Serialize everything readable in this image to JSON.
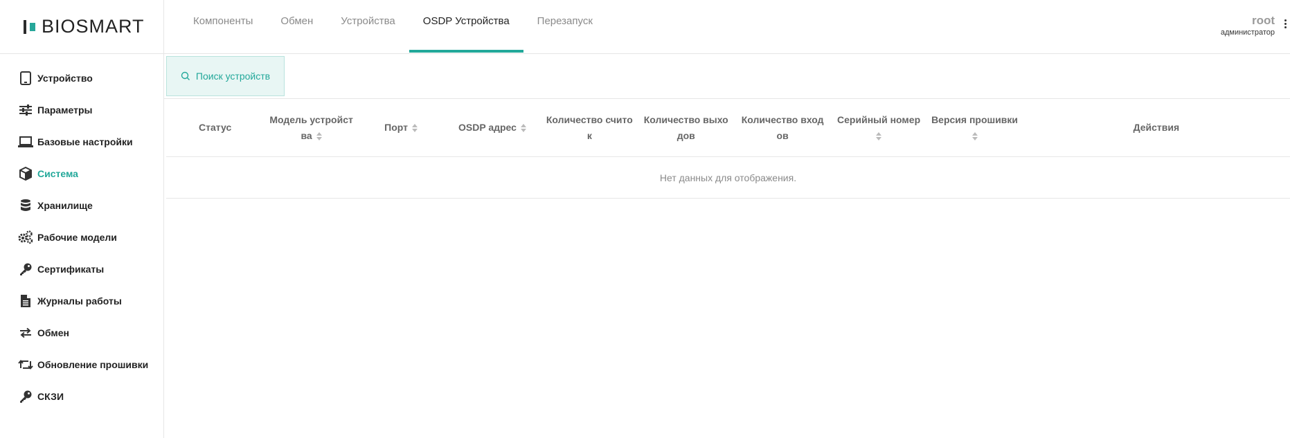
{
  "brand": {
    "name": "BIOSMART"
  },
  "sidebar": {
    "items": [
      {
        "label": "Устройство",
        "icon": "tablet-icon",
        "active": false
      },
      {
        "label": "Параметры",
        "icon": "sliders-icon",
        "active": false
      },
      {
        "label": "Базовые настройки",
        "icon": "laptop-icon",
        "active": false
      },
      {
        "label": "Система",
        "icon": "cube-icon",
        "active": true
      },
      {
        "label": "Хранилище",
        "icon": "database-icon",
        "active": false
      },
      {
        "label": "Рабочие модели",
        "icon": "gears-icon",
        "active": false
      },
      {
        "label": "Сертификаты",
        "icon": "key-icon",
        "active": false
      },
      {
        "label": "Журналы работы",
        "icon": "file-icon",
        "active": false
      },
      {
        "label": "Обмен",
        "icon": "exchange-icon",
        "active": false
      },
      {
        "label": "Обновление прошивки",
        "icon": "retweet-icon",
        "active": false
      },
      {
        "label": "СКЗИ",
        "icon": "key-icon",
        "active": false
      }
    ]
  },
  "tabs": [
    {
      "label": "Компоненты",
      "active": false
    },
    {
      "label": "Обмен",
      "active": false
    },
    {
      "label": "Устройства",
      "active": false
    },
    {
      "label": "OSDP Устройства",
      "active": true
    },
    {
      "label": "Перезапуск",
      "active": false
    }
  ],
  "user": {
    "name": "root",
    "role": "администратор"
  },
  "toolbar": {
    "search_label": "Поиск устройств"
  },
  "table": {
    "columns": [
      {
        "l1": "Статус",
        "l2": "",
        "sortable": false
      },
      {
        "l1": "Модель устройст",
        "l2": "ва",
        "sortable": true
      },
      {
        "l1": "Порт",
        "l2": "",
        "sortable": true
      },
      {
        "l1": "OSDP адрес",
        "l2": "",
        "sortable": true
      },
      {
        "l1": "Количество счито",
        "l2": "к",
        "sortable": false
      },
      {
        "l1": "Количество выхо",
        "l2": "дов",
        "sortable": false
      },
      {
        "l1": "Количество вход",
        "l2": "ов",
        "sortable": false
      },
      {
        "l1": "Серийный номер",
        "l2": "",
        "sortable": true
      },
      {
        "l1": "Версия прошивки",
        "l2": "",
        "sortable": true
      },
      {
        "l1": "Действия",
        "l2": "",
        "sortable": false
      }
    ],
    "empty_text": "Нет данных для отображения."
  },
  "colors": {
    "accent": "#22a89a",
    "accent_bg": "#e8f6f4",
    "muted": "#8a8a8a"
  }
}
